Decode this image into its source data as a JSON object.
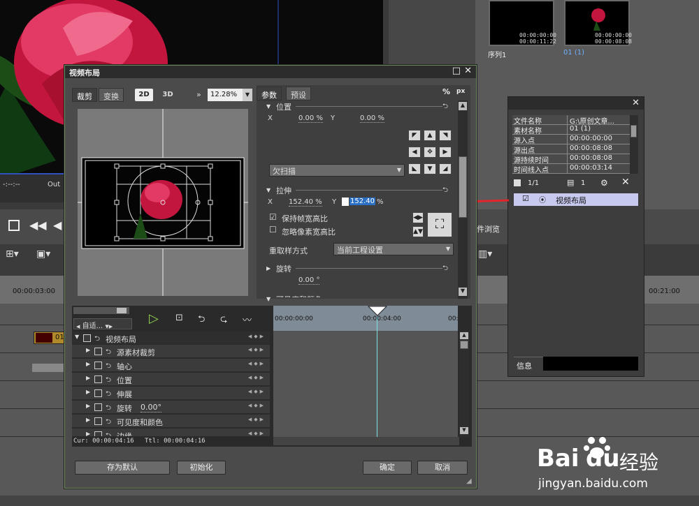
{
  "background": {
    "preview_timecode": "-:--:--",
    "preview_out_label": "Out",
    "thumbs": [
      {
        "label": "序列1",
        "tc1": "00:00:00:00",
        "tc2": "00:00:11:22"
      },
      {
        "label": "01 (1)",
        "tc1": "00:00:00:00",
        "tc2": "00:00:08:08"
      }
    ],
    "timeline_tc_left": "00:00:03:00",
    "timeline_tc_right": "00:21:00",
    "clip_label": "01",
    "browse_label": "件浏览"
  },
  "dialog": {
    "title": "视频布局",
    "left_tabs": [
      "裁剪",
      "变换"
    ],
    "mode_2d": "2D",
    "mode_3d": "3D",
    "zoom": "12.28%",
    "right_tabs": [
      "参数",
      "预设"
    ],
    "unit_percent": "%",
    "unit_px": "px",
    "position": {
      "title": "位置",
      "x_label": "X",
      "x_value": "0.00 %",
      "y_label": "Y",
      "y_value": "0.00 %"
    },
    "overscan_option": "欠扫描",
    "stretch": {
      "title": "拉伸",
      "x_label": "X",
      "x_value": "152.40 %",
      "y_label": "Y",
      "y_value": "152.40",
      "y_unit": "%"
    },
    "keep_aspect_label": "保持帧宽高比",
    "keep_aspect_checked": true,
    "ignore_pixel_label": "忽略像素宽高比",
    "ignore_pixel_checked": false,
    "resample_label": "重取样方式",
    "resample_value": "当前工程设置",
    "rotate": {
      "title": "旋转",
      "value": "0.00 °"
    },
    "next_section": "可见度和颜色",
    "timeline": {
      "fit_label": "自适...",
      "tc_start": "00:00:00:00",
      "tc_mid": "00:00:04:00",
      "tc_end": "00:",
      "root": "视频布局",
      "tracks": [
        "源素材裁剪",
        "轴心",
        "位置",
        "伸展",
        "旋转",
        "可见度和颜色",
        "边缘"
      ],
      "rotate_value": "0.00°",
      "cur_label": "Cur: 00:00:04:16",
      "ttl_label": "Ttl: 00:00:04:16"
    },
    "buttons": {
      "save_default": "存为默认",
      "init": "初始化",
      "ok": "确定",
      "cancel": "取消"
    }
  },
  "info_panel": {
    "rows": [
      {
        "k": "文件名称",
        "v": "G:\\原创文章..."
      },
      {
        "k": "素材名称",
        "v": "01 (1)"
      },
      {
        "k": "源入点",
        "v": "00:00:00:00"
      },
      {
        "k": "源出点",
        "v": "00:00:08:08"
      },
      {
        "k": "源持续时间",
        "v": "00:00:08:08"
      },
      {
        "k": "时间线入点",
        "v": "00:00:03:14"
      }
    ],
    "page": "1/1",
    "count": "1",
    "effect_item": "视频布局",
    "tab_label": "信息"
  },
  "watermark": {
    "brand": "Bai",
    "brand2": "du",
    "suffix": "经验",
    "url": "jingyan.baidu.com"
  }
}
